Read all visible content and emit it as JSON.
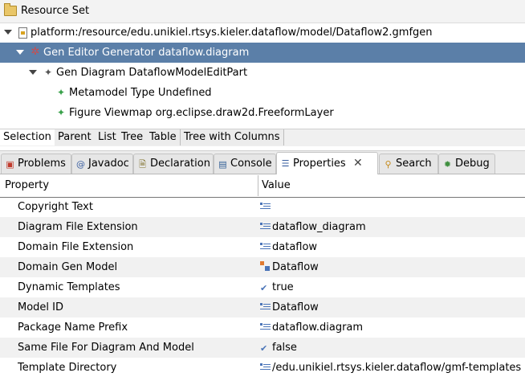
{
  "resource_set": {
    "title": "Resource Set",
    "icon": "folder-icon"
  },
  "tree": {
    "items": [
      {
        "label": "platform:/resource/edu.unikiel.rtsys.kieler.dataflow/model/Dataflow2.gmfgen",
        "icon": "resource-file-icon",
        "expanded": true
      },
      {
        "label": "Gen Editor Generator dataflow.diagram",
        "icon": "gen-editor-icon",
        "expanded": true,
        "selected": true
      },
      {
        "label": "Gen Diagram DataflowModelEditPart",
        "icon": "gen-diagram-icon",
        "expanded": true
      },
      {
        "label": "Metamodel Type Undefined",
        "icon": "metamodel-type-icon"
      },
      {
        "label": "Figure Viewmap org.eclipse.draw2d.FreeformLayer",
        "icon": "figure-viewmap-icon"
      }
    ]
  },
  "view_tabs": [
    "Selection",
    "Parent",
    "List",
    "Tree",
    "Table",
    "Tree with Columns"
  ],
  "bottom_tabs": [
    {
      "label": "Problems",
      "icon": "problems-icon"
    },
    {
      "label": "Javadoc",
      "icon": "javadoc-icon"
    },
    {
      "label": "Declaration",
      "icon": "declaration-icon"
    },
    {
      "label": "Console",
      "icon": "console-icon"
    },
    {
      "label": "Properties",
      "icon": "properties-icon",
      "active": true,
      "close": "✕"
    },
    {
      "label": "Search",
      "icon": "search-icon"
    },
    {
      "label": "Debug",
      "icon": "debug-icon"
    }
  ],
  "properties": {
    "columns": {
      "property": "Property",
      "value": "Value"
    },
    "rows": [
      {
        "name": "Copyright Text",
        "value": "",
        "type": "text"
      },
      {
        "name": "Diagram File Extension",
        "value": "dataflow_diagram",
        "type": "text"
      },
      {
        "name": "Domain File Extension",
        "value": "dataflow",
        "type": "text"
      },
      {
        "name": "Domain Gen Model",
        "value": "Dataflow",
        "type": "model"
      },
      {
        "name": "Dynamic Templates",
        "value": "true",
        "type": "bool"
      },
      {
        "name": "Model ID",
        "value": "Dataflow",
        "type": "text"
      },
      {
        "name": "Package Name Prefix",
        "value": "dataflow.diagram",
        "type": "text"
      },
      {
        "name": "Same File For Diagram And Model",
        "value": "false",
        "type": "bool"
      },
      {
        "name": "Template Directory",
        "value": "/edu.unikiel.rtsys.kieler.dataflow/gmf-templates",
        "type": "text"
      }
    ]
  },
  "colors": {
    "selection": "#5b7fa8",
    "alt_row": "#f1f1f1",
    "accent": "#4a74b8"
  }
}
